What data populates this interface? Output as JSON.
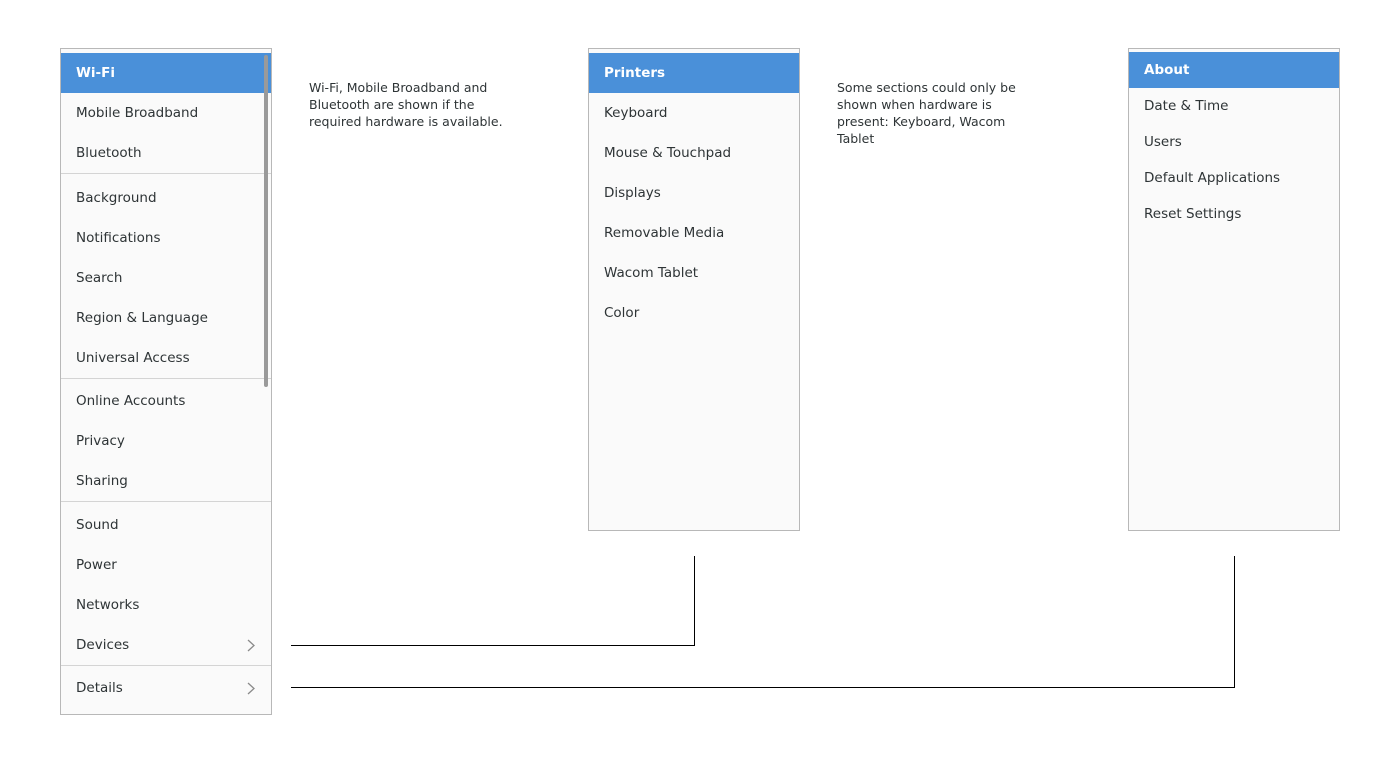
{
  "left_panel": {
    "items": [
      {
        "label": "Wi-Fi"
      },
      {
        "label": "Mobile Broadband"
      },
      {
        "label": "Bluetooth"
      },
      {
        "label": "Background"
      },
      {
        "label": "Notifications"
      },
      {
        "label": "Search"
      },
      {
        "label": "Region & Language"
      },
      {
        "label": "Universal Access"
      },
      {
        "label": "Online Accounts"
      },
      {
        "label": "Privacy"
      },
      {
        "label": "Sharing"
      },
      {
        "label": "Sound"
      },
      {
        "label": "Power"
      },
      {
        "label": "Networks"
      },
      {
        "label": "Devices"
      },
      {
        "label": "Details"
      }
    ]
  },
  "devices_panel": {
    "items": [
      {
        "label": "Printers"
      },
      {
        "label": "Keyboard"
      },
      {
        "label": "Mouse & Touchpad"
      },
      {
        "label": "Displays"
      },
      {
        "label": "Removable Media"
      },
      {
        "label": "Wacom Tablet"
      },
      {
        "label": "Color"
      }
    ]
  },
  "details_panel": {
    "items": [
      {
        "label": "About"
      },
      {
        "label": "Date & Time"
      },
      {
        "label": "Users"
      },
      {
        "label": "Default Applications"
      },
      {
        "label": "Reset Settings"
      }
    ]
  },
  "notes": {
    "note1": "Wi-Fi, Mobile Broadband and Bluetooth are shown if the required hardware is available.",
    "note2": "Some sections could only be shown when hardware is present: Keyboard, Wacom Tablet"
  },
  "colors": {
    "selected": "#4a90d9",
    "panel_bg": "#fafafa"
  }
}
